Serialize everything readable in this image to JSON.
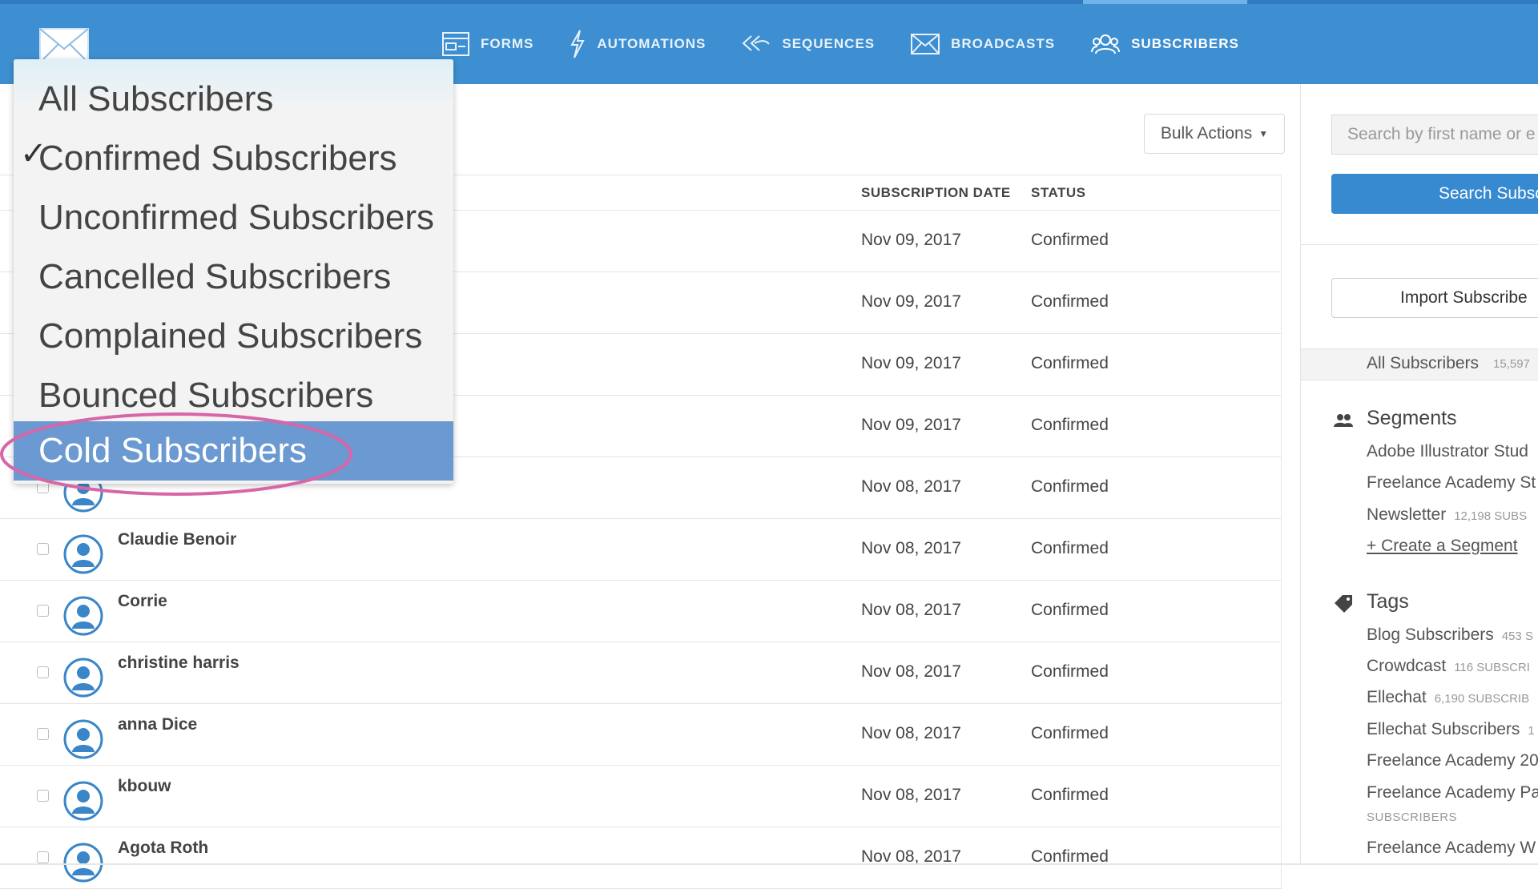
{
  "nav": {
    "items": [
      {
        "label": "FORMS",
        "icon": "forms-icon"
      },
      {
        "label": "AUTOMATIONS",
        "icon": "lightning-icon"
      },
      {
        "label": "SEQUENCES",
        "icon": "sequences-icon"
      },
      {
        "label": "BROADCASTS",
        "icon": "envelope-icon"
      },
      {
        "label": "SUBSCRIBERS",
        "icon": "subscribers-icon",
        "active": true
      }
    ]
  },
  "toolbar": {
    "bulk_actions_label": "Bulk Actions"
  },
  "table": {
    "headers": {
      "date": "SUBSCRIPTION DATE",
      "status": "STATUS"
    },
    "rows": [
      {
        "name": "",
        "date": "Nov 09, 2017",
        "status": "Confirmed"
      },
      {
        "name": "",
        "date": "Nov 09, 2017",
        "status": "Confirmed"
      },
      {
        "name": "",
        "date": "Nov 09, 2017",
        "status": "Confirmed"
      },
      {
        "name": "",
        "date": "Nov 09, 2017",
        "status": "Confirmed"
      },
      {
        "name": "",
        "date": "Nov 08, 2017",
        "status": "Confirmed"
      },
      {
        "name": "Claudie Benoir",
        "date": "Nov 08, 2017",
        "status": "Confirmed"
      },
      {
        "name": "Corrie",
        "date": "Nov 08, 2017",
        "status": "Confirmed"
      },
      {
        "name": "christine harris",
        "date": "Nov 08, 2017",
        "status": "Confirmed"
      },
      {
        "name": "anna Dice",
        "date": "Nov 08, 2017",
        "status": "Confirmed"
      },
      {
        "name": "kbouw",
        "date": "Nov 08, 2017",
        "status": "Confirmed"
      },
      {
        "name": "Agota Roth",
        "date": "Nov 08, 2017",
        "status": "Confirmed"
      }
    ]
  },
  "dropdown": {
    "items": [
      {
        "label": "All Subscribers"
      },
      {
        "label": "Confirmed Subscribers",
        "checked": true
      },
      {
        "label": "Unconfirmed Subscribers"
      },
      {
        "label": "Cancelled Subscribers"
      },
      {
        "label": "Complained Subscribers"
      },
      {
        "label": "Bounced Subscribers"
      },
      {
        "label": "Cold Subscribers",
        "highlighted": true
      }
    ],
    "check_mark": "✓"
  },
  "sidebar": {
    "search_placeholder": "Search by first name or e",
    "search_button": "Search Subsc",
    "import_button": "Import Subscribe",
    "all_subscribers": {
      "label": "All Subscribers",
      "count": "15,597"
    },
    "segments": {
      "title": "Segments",
      "items": [
        {
          "label": "Adobe Illustrator Stud",
          "count": ""
        },
        {
          "label": "Freelance Academy St",
          "count": ""
        },
        {
          "label": "Newsletter",
          "count": "12,198 SUBS"
        }
      ],
      "create_link": "+ Create a Segment"
    },
    "tags": {
      "title": "Tags",
      "items": [
        {
          "label": "Blog Subscribers",
          "count": "453 S"
        },
        {
          "label": "Crowdcast",
          "count": "116 SUBSCRI"
        },
        {
          "label": "Ellechat",
          "count": "6,190 SUBSCRIB"
        },
        {
          "label": "Ellechat Subscribers",
          "count": "1"
        },
        {
          "label": "Freelance Academy 20",
          "count": ""
        },
        {
          "label": "Freelance Academy Pa",
          "count": ""
        },
        {
          "label": "Freelance Academy W",
          "count": ""
        }
      ],
      "sub_label": "SUBSCRIBERS"
    }
  },
  "colors": {
    "nav_bg": "#3d8fd1",
    "accent": "#3789d0",
    "dropdown_selected": "#6b99d1",
    "annotation_ring": "#d766a8"
  }
}
